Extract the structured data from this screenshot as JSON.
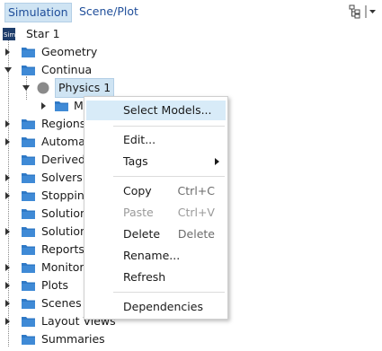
{
  "tabs": [
    {
      "label": "Simulation",
      "active": true
    },
    {
      "label": "Scene/Plot",
      "active": false
    }
  ],
  "toolbar": {
    "tree_icon": "tree-structure-icon",
    "menu_icon": "dropdown-menu-icon"
  },
  "tree": {
    "root": {
      "label": "Star 1",
      "icon": "star-sim-icon"
    },
    "geometry": "Geometry",
    "continua": "Continua",
    "physics": "Physics 1",
    "models": "Mod",
    "regions": "Regions",
    "automation": "Automation",
    "derived": "Derived Pa",
    "solvers": "Solvers",
    "stopping": "Stopping",
    "solution_h": "Solution H",
    "solution_v": "Solution V",
    "reports": "Reports",
    "monitors": "Monitors",
    "plots": "Plots",
    "scenes": "Scenes",
    "layout_views": "Layout Views",
    "summaries": "Summaries"
  },
  "context_menu": {
    "select_models": "Select Models...",
    "edit": "Edit...",
    "tags": "Tags",
    "copy": "Copy",
    "copy_shortcut": "Ctrl+C",
    "paste": "Paste",
    "paste_shortcut": "Ctrl+V",
    "delete": "Delete",
    "delete_shortcut": "Delete",
    "rename": "Rename...",
    "refresh": "Refresh",
    "dependencies": "Dependencies"
  },
  "colors": {
    "selection": "#cfe4f3",
    "folder": "#2f79c6",
    "link": "#1f4e9a"
  }
}
